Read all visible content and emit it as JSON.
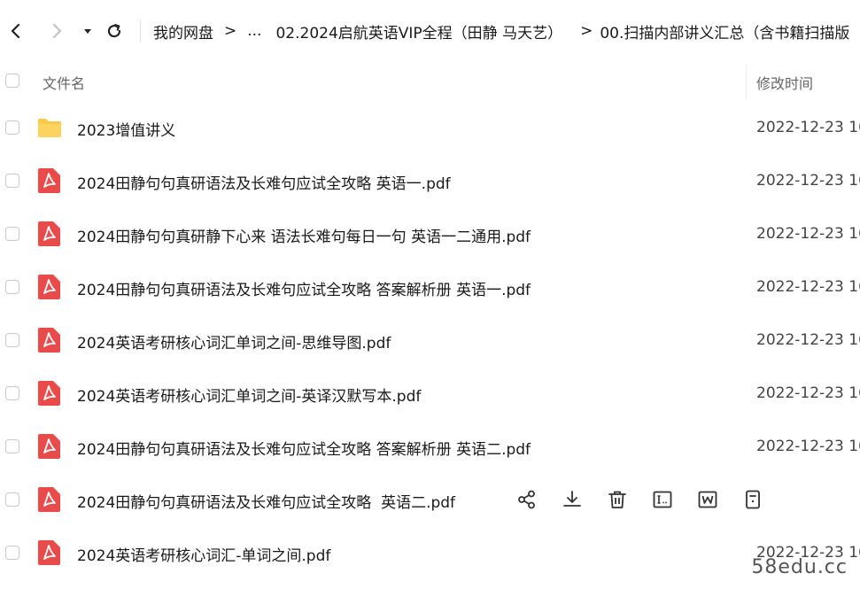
{
  "breadcrumb": [
    {
      "label": "我的网盘"
    },
    {
      "label": "..."
    },
    {
      "label": "02.2024启航英语VIP全程（田静 马天艺）"
    },
    {
      "label": "00.扫描内部讲义汇总（含书籍扫描版"
    }
  ],
  "breadcrumb_separator": ">",
  "columns": {
    "name": "文件名",
    "time": "修改时间"
  },
  "files": [
    {
      "type": "folder",
      "name": "2023增值讲义",
      "time": "2022-12-23 16"
    },
    {
      "type": "pdf",
      "name": "2024田静句句真研语法及长难句应试全攻略 英语一.pdf",
      "time": "2022-12-23 16"
    },
    {
      "type": "pdf",
      "name": "2024田静句句真研静下心来 语法长难句每日一句 英语一二通用.pdf",
      "time": "2022-12-23 16"
    },
    {
      "type": "pdf",
      "name": "2024田静句句真研语法及长难句应试全攻略 答案解析册 英语一.pdf",
      "time": "2022-12-23 16"
    },
    {
      "type": "pdf",
      "name": "2024英语考研核心词汇单词之间-思维导图.pdf",
      "time": "2022-12-23 16"
    },
    {
      "type": "pdf",
      "name": "2024英语考研核心词汇单词之间-英译汉默写本.pdf",
      "time": "2022-12-23 16"
    },
    {
      "type": "pdf",
      "name": "2024田静句句真研语法及长难句应试全攻略 答案解析册 英语二.pdf",
      "time": "2022-12-23 16"
    },
    {
      "type": "pdf",
      "name": "2024田静句句真研语法及长难句应试全攻略  英语二.pdf",
      "time": ""
    },
    {
      "type": "pdf",
      "name": "2024英语考研核心词汇-单词之间.pdf",
      "time": "2022-12-23 16"
    }
  ],
  "hover_actions": [
    "share-icon",
    "download-icon",
    "delete-icon",
    "rename-icon",
    "word-convert-icon",
    "more-icon"
  ],
  "watermark": "58edu.cc",
  "colors": {
    "folder": "#f9c94a",
    "pdf": "#e94b4b",
    "icon_dark": "#333333"
  }
}
